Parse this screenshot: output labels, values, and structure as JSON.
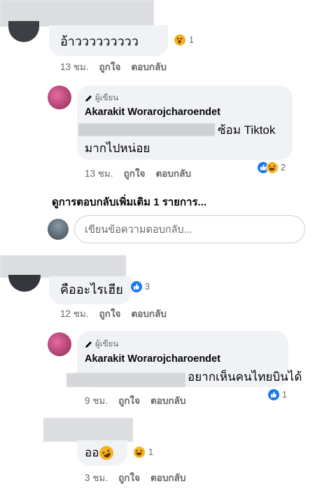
{
  "comments": [
    {
      "text": "อ้าววววววววว",
      "reaction_count": "1",
      "time": "13 ชม.",
      "like_label": "ถูกใจ",
      "reply_label": "ตอบกลับ"
    },
    {
      "author_tag": "ผู้เขียน",
      "name": "Akarakit Worarojcharoendet",
      "text_line1": "ซ้อม Tiktok",
      "text_line2": "มากไปหน่อย",
      "reaction_count": "2",
      "time": "13 ชม.",
      "like_label": "ถูกใจ",
      "reply_label": "ตอบกลับ"
    },
    {
      "text": "คืออะไรเฮีย",
      "reaction_count": "3",
      "time": "12 ชม.",
      "like_label": "ถูกใจ",
      "reply_label": "ตอบกลับ"
    },
    {
      "author_tag": "ผู้เขียน",
      "name": "Akarakit Worarojcharoendet",
      "text_visible": "อยากเห็นคนไทยบินได้",
      "reaction_count": "1",
      "time": "9 ชม.",
      "like_label": "ถูกใจ",
      "reply_label": "ตอบกลับ"
    },
    {
      "text": "ออ",
      "reaction_count": "1",
      "time": "3 ชม.",
      "like_label": "ถูกใจ",
      "reply_label": "ตอบกลับ"
    }
  ],
  "more_replies": "ดูการตอบกลับเพิ่มเติม 1 รายการ...",
  "reply_input": {
    "placeholder": "เขียนข้อความตอบกลับ..."
  },
  "colors": {
    "bubble": "#f0f2f5",
    "like": "#1877f2",
    "haha": "#f7b125",
    "meta": "#65676b"
  },
  "icons": [
    "pencil-icon",
    "like-reaction-icon",
    "haha-reaction-icon",
    "rofl-emoji-icon"
  ]
}
